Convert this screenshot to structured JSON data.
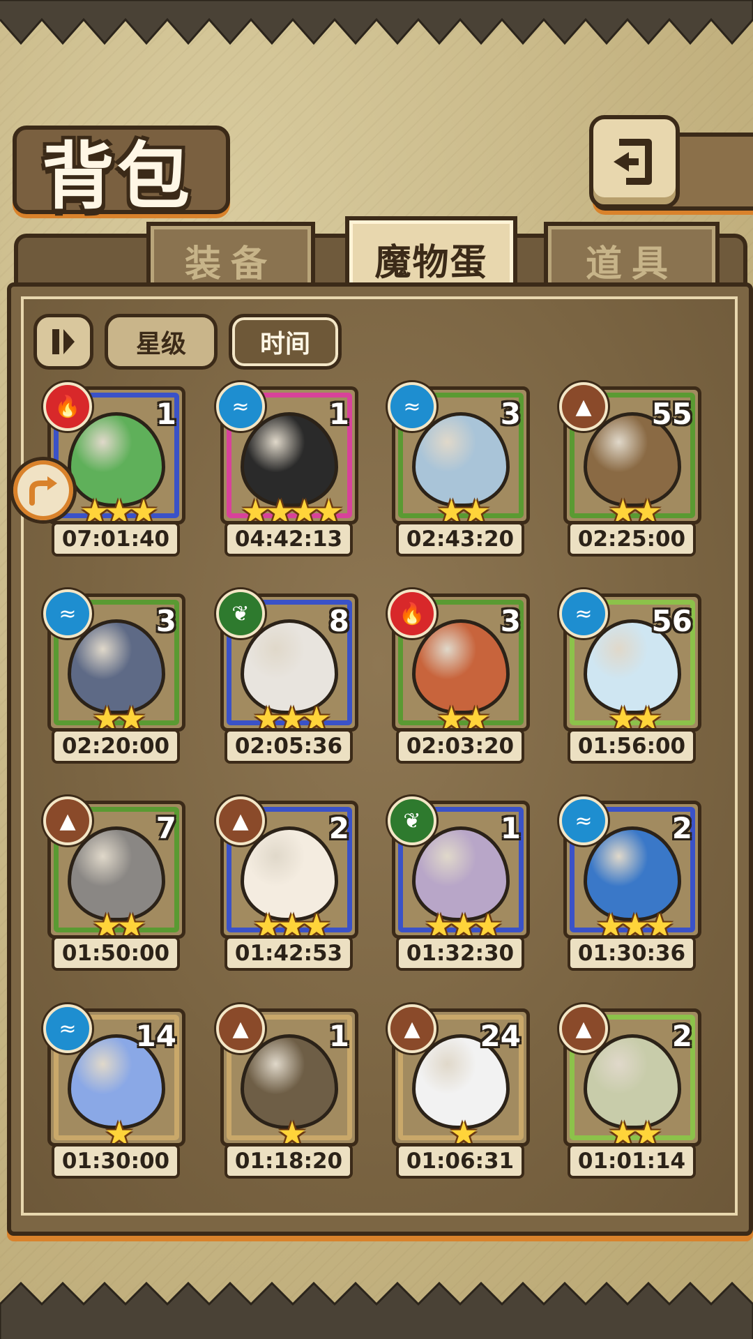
{
  "header": {
    "title": "背包"
  },
  "tabs": [
    {
      "label": "装备",
      "active": false
    },
    {
      "label": "魔物蛋",
      "active": true
    },
    {
      "label": "道具",
      "active": false
    }
  ],
  "sort": {
    "toggle_icon": "pause-bars-icon",
    "buttons": [
      {
        "label": "星级",
        "active": false
      },
      {
        "label": "时间",
        "active": true
      }
    ]
  },
  "colors": {
    "fire": "#d8282a",
    "water": "#1e8ed0",
    "earth": "#8a4a2a",
    "wood": "#2e7a2e",
    "frame_green": "#5a9a32",
    "frame_blue": "#3a52c8",
    "frame_pink": "#d8429a",
    "frame_tan": "#c9a86a",
    "frame_light": "#8cc24a"
  },
  "eggs": [
    {
      "element": "fire",
      "elem_icon": "flame-icon",
      "count": "1",
      "stars": 3,
      "time": "07:01:40",
      "frame": "frame_blue",
      "color": "#5fb05a"
    },
    {
      "element": "water",
      "elem_icon": "water-icon",
      "count": "1",
      "stars": 4,
      "time": "04:42:13",
      "frame": "frame_pink",
      "color": "#2a2a2a"
    },
    {
      "element": "water",
      "elem_icon": "water-icon",
      "count": "3",
      "stars": 2,
      "time": "02:43:20",
      "frame": "frame_green",
      "color": "#a9c4d8"
    },
    {
      "element": "earth",
      "elem_icon": "mountain-icon",
      "count": "55",
      "stars": 2,
      "time": "02:25:00",
      "frame": "frame_green",
      "color": "#8a6a44"
    },
    {
      "element": "water",
      "elem_icon": "water-icon",
      "count": "3",
      "stars": 2,
      "time": "02:20:00",
      "frame": "frame_green",
      "color": "#5e6a86"
    },
    {
      "element": "wood",
      "elem_icon": "leaf-icon",
      "count": "8",
      "stars": 3,
      "time": "02:05:36",
      "frame": "frame_blue",
      "color": "#e8e4de"
    },
    {
      "element": "fire",
      "elem_icon": "flame-icon",
      "count": "3",
      "stars": 2,
      "time": "02:03:20",
      "frame": "frame_green",
      "color": "#c8643c"
    },
    {
      "element": "water",
      "elem_icon": "water-icon",
      "count": "56",
      "stars": 2,
      "time": "01:56:00",
      "frame": "frame_light",
      "color": "#cfe6f2"
    },
    {
      "element": "earth",
      "elem_icon": "mountain-icon",
      "count": "7",
      "stars": 2,
      "time": "01:50:00",
      "frame": "frame_green",
      "color": "#8a8784"
    },
    {
      "element": "earth",
      "elem_icon": "mountain-icon",
      "count": "2",
      "stars": 3,
      "time": "01:42:53",
      "frame": "frame_blue",
      "color": "#f4ece0"
    },
    {
      "element": "wood",
      "elem_icon": "leaf-icon",
      "count": "1",
      "stars": 3,
      "time": "01:32:30",
      "frame": "frame_blue",
      "color": "#b8a6c8"
    },
    {
      "element": "water",
      "elem_icon": "water-icon",
      "count": "2",
      "stars": 3,
      "time": "01:30:36",
      "frame": "frame_blue",
      "color": "#3a78c8"
    },
    {
      "element": "water",
      "elem_icon": "water-icon",
      "count": "14",
      "stars": 1,
      "time": "01:30:00",
      "frame": "frame_tan",
      "color": "#8aa8e6"
    },
    {
      "element": "earth",
      "elem_icon": "mountain-icon",
      "count": "1",
      "stars": 1,
      "time": "01:18:20",
      "frame": "frame_tan",
      "color": "#6e5e46"
    },
    {
      "element": "earth",
      "elem_icon": "mountain-icon",
      "count": "24",
      "stars": 1,
      "time": "01:06:31",
      "frame": "frame_tan",
      "color": "#f2f2f2"
    },
    {
      "element": "earth",
      "elem_icon": "mountain-icon",
      "count": "2",
      "stars": 2,
      "time": "01:01:14",
      "frame": "frame_light",
      "color": "#c8ccaa"
    }
  ]
}
